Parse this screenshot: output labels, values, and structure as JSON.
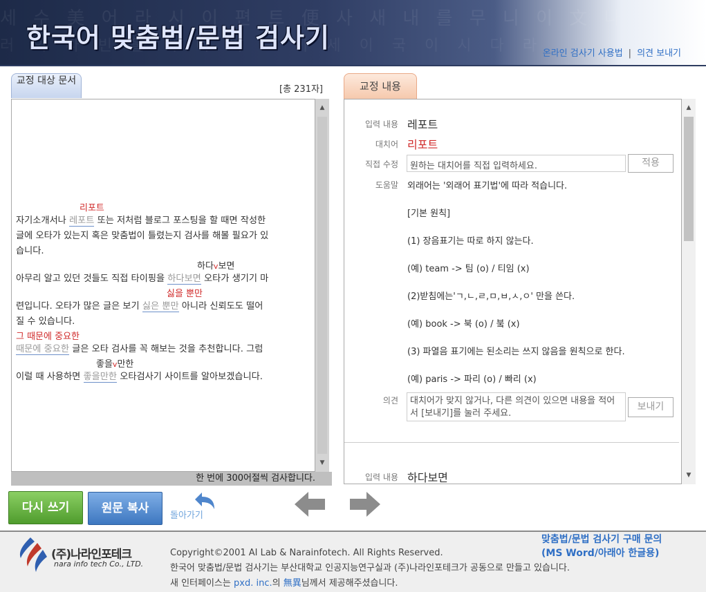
{
  "header": {
    "title": "한국어 맞춤법/문법 검사기",
    "bg_text_1": "세 수 美 어 라 시 이 편 트 便 사 새 내 를 무 니 이 文 나",
    "bg_text_2": "러 의 다 빈 울 이 마 이 보 이 세 이 국 이 시 다 라",
    "links": [
      "온라인 검사기 사용법",
      "의견 보내기"
    ],
    "separator": "|"
  },
  "left_tab": {
    "label": "교정 대상 문서"
  },
  "char_count": "[총 231자]",
  "document": {
    "footer_note": "한 번에 300어절씩 검사합니다.",
    "lines": [
      {
        "parts": [
          "자기소개서나 ",
          "레포트",
          " 또는 저처럼 블로그 포스팅을 할 때면 작성한"
        ]
      },
      {
        "text": "글에 오타가 있는지 혹은 맞춤법이 틀렸는지 검사를 해볼 필요가 있"
      },
      {
        "text": "습니다."
      },
      {
        "parts": [
          "아무리 알고 있던 것들도 직접 타이핑을 ",
          "하다보면",
          " 오타가 생기기 마"
        ]
      },
      {
        "text": "련입니다. 오타가 많은 글은 보기 "
      },
      {
        "parts": [
          "싫은 뿐만",
          " 아니라 신뢰도도 떨어"
        ]
      },
      {
        "text": "질 수 있습니다."
      },
      {
        "parts": [
          "때문에 중요한",
          " 글은 오타 검사를 꼭 해보는 것을 추천합니다. 그럼"
        ]
      },
      {
        "parts": [
          "이럴 때 사용하면 ",
          "좋을만한",
          " 오타검사기 사이트를 알아보겠습니다."
        ]
      }
    ],
    "suggestions": {
      "s1": "리포트",
      "s2a": "하다",
      "s2caret": "v",
      "s2b": "보면",
      "s3": "싫을 뿐만",
      "s4": "그 때문에 중요한",
      "s5a": "좋을",
      "s5caret": "v",
      "s5b": "만한"
    }
  },
  "right_tab": {
    "label": "교정 내용"
  },
  "correction": {
    "input_label": "입력 내용",
    "input_value": "레포트",
    "replace_label": "대치어",
    "replace_value": "리포트",
    "direct_label": "직접 수정",
    "direct_placeholder": "원하는 대치어를 직접 입력하세요.",
    "apply_button": "적용",
    "help_label": "도움말",
    "help_lines": [
      "외래어는 '외래어 표기법'에 따라 적습니다.",
      "[기본 원칙]",
      "(1) 장음표기는 따로 하지 않는다.",
      "(예) team -> 팀 (o) / 티임 (x)",
      "(2)받침에는'ㄱ,ㄴ,ㄹ,ㅁ,ㅂ,ㅅ,ㅇ' 만을 쓴다.",
      "(예) book -> 북 (o) / 붘 (x)",
      "(3) 파열음 표기에는 된소리는 쓰지 않음을 원칙으로 한다.",
      "(예) paris -> 파리 (o) / 빠리 (x)"
    ],
    "opinion_label": "의견",
    "opinion_placeholder": "대치어가 맞지 않거나, 다른 의견이 있으면 내용을 적어서 [보내기]를 눌러 주세요.",
    "send_button": "보내기",
    "next_input_label": "입력 내용",
    "next_input_value": "하다보면"
  },
  "buttons": {
    "rewrite": "다시 쓰기",
    "copy_original": "원문 복사",
    "go_back": "돌아가기"
  },
  "footer": {
    "logo_ko": "(주)나라인포테크",
    "logo_en": "nara info tech Co., LTD.",
    "copyright": "Copyright©2001 AI Lab & Narainfotech. All Rights Reserved.",
    "line2": "한국어 맞춤법/문법 검사기는 부산대학교 인공지능연구실과 (주)나라인포테크가 공동으로 만들고 있습니다.",
    "line3_pre": "새 인터페이스는 ",
    "line3_link1": "pxd. inc.",
    "line3_mid": "의 ",
    "line3_link2": "無異",
    "line3_post": "님께서 제공해주셨습니다.",
    "buy_line1": "맞춤법/문법 검사기 구매 문의",
    "buy_line2": "(MS Word/아래아 한글용)"
  },
  "colors": {
    "error_suggestion": "#d02a2a",
    "link": "#2f6fc5",
    "green_button": "#5fae3a",
    "blue_button": "#4f86cc"
  }
}
